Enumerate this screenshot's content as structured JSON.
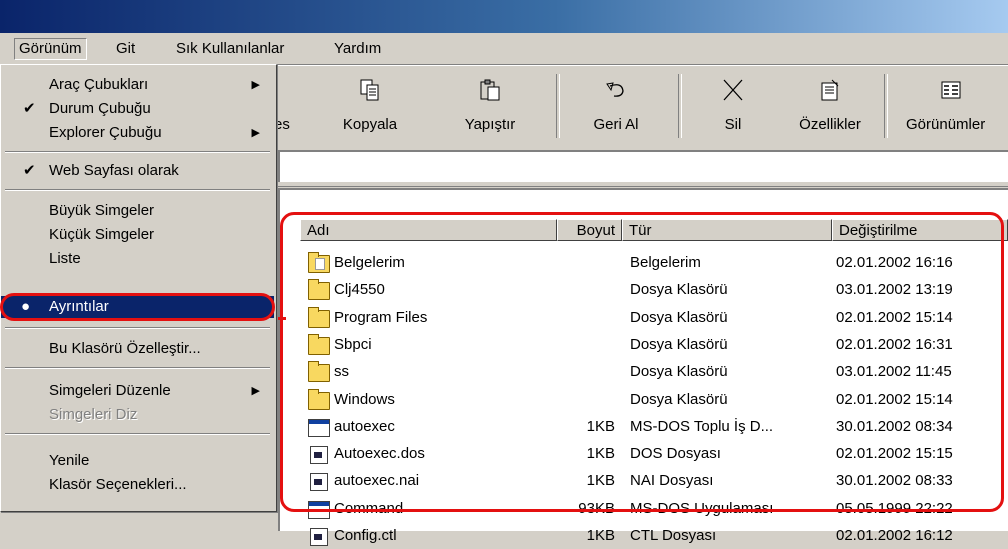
{
  "menubar": {
    "items": [
      "Görünüm",
      "Git",
      "Sık Kullanılanlar",
      "Yardım"
    ]
  },
  "toolbar": {
    "buttons": [
      "es",
      "Kopyala",
      "Yapıştır",
      "Geri Al",
      "Sil",
      "Özellikler",
      "Görünümler"
    ],
    "icons": [
      "cut-icon",
      "copy-icon",
      "paste-icon",
      "undo-icon",
      "delete-icon",
      "properties-icon",
      "views-icon"
    ]
  },
  "view_menu": {
    "items": [
      {
        "label": "Araç Çubukları",
        "submenu": true
      },
      {
        "label": "Durum Çubuğu",
        "checked": true
      },
      {
        "label": "Explorer Çubuğu",
        "submenu": true
      },
      {
        "label": "Web Sayfası olarak",
        "checked": true
      },
      {
        "label": "Büyük Simgeler"
      },
      {
        "label": "Küçük Simgeler"
      },
      {
        "label": "Liste"
      },
      {
        "label": "Ayrıntılar",
        "selected": true,
        "bullet": true
      },
      {
        "label": "Bu Klasörü Özelleştir..."
      },
      {
        "label": "Simgeleri Düzenle",
        "submenu": true
      },
      {
        "label": "Simgeleri Diz",
        "disabled": true
      },
      {
        "label": "Yenile"
      },
      {
        "label": "Klasör Seçenekleri..."
      }
    ]
  },
  "file_list": {
    "columns": [
      "Adı",
      "Boyut",
      "Tür",
      "Değiştirilme"
    ],
    "rows": [
      {
        "name": "Belgelerim",
        "size": "",
        "type": "Belgelerim",
        "modified": "02.01.2002 16:16",
        "icon": "my-documents-icon"
      },
      {
        "name": "Clj4550",
        "size": "",
        "type": "Dosya Klasörü",
        "modified": "03.01.2002 13:19",
        "icon": "folder-icon"
      },
      {
        "name": "Program Files",
        "size": "",
        "type": "Dosya Klasörü",
        "modified": "02.01.2002 15:14",
        "icon": "folder-icon"
      },
      {
        "name": "Sbpci",
        "size": "",
        "type": "Dosya Klasörü",
        "modified": "02.01.2002 16:31",
        "icon": "folder-icon"
      },
      {
        "name": "ss",
        "size": "",
        "type": "Dosya Klasörü",
        "modified": "03.01.2002 11:45",
        "icon": "folder-icon"
      },
      {
        "name": "Windows",
        "size": "",
        "type": "Dosya Klasörü",
        "modified": "02.01.2002 15:14",
        "icon": "folder-icon"
      },
      {
        "name": "autoexec",
        "size": "1KB",
        "type": "MS-DOS Toplu İş D...",
        "modified": "30.01.2002 08:34",
        "icon": "batch-file-icon"
      },
      {
        "name": "Autoexec.dos",
        "size": "1KB",
        "type": "DOS Dosyası",
        "modified": "02.01.2002 15:15",
        "icon": "file-icon"
      },
      {
        "name": "autoexec.nai",
        "size": "1KB",
        "type": "NAI Dosyası",
        "modified": "30.01.2002 08:33",
        "icon": "file-icon"
      },
      {
        "name": "Command",
        "size": "93KB",
        "type": "MS-DOS Uygulaması",
        "modified": "05.05.1999 22:22",
        "icon": "application-icon"
      },
      {
        "name": "Config.ctl",
        "size": "1KB",
        "type": "CTL Dosyası",
        "modified": "02.01.2002 16:12",
        "icon": "file-icon"
      }
    ]
  }
}
